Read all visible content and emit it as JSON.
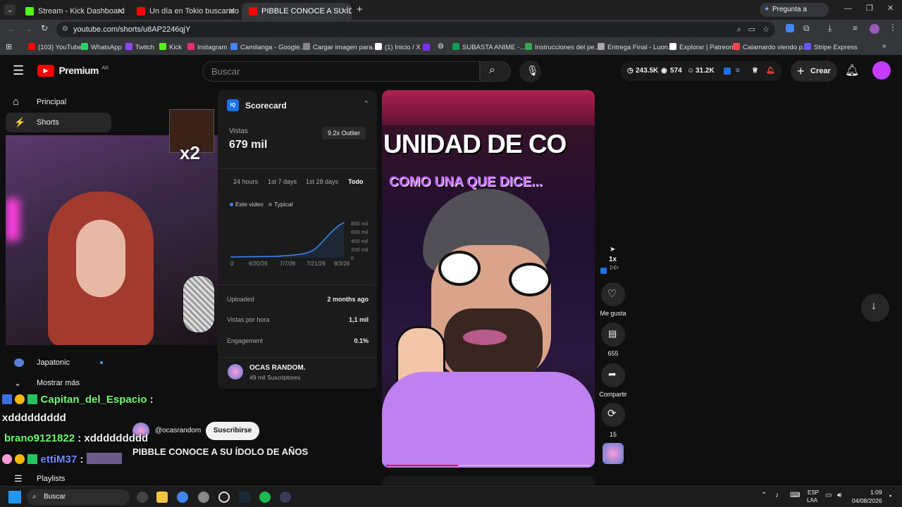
{
  "browser": {
    "tabs": [
      {
        "title": "Stream - Kick Dashboard",
        "color": "#53fc18"
      },
      {
        "title": "Un día en Tokio buscando JOYA",
        "color": "#ff0000"
      },
      {
        "title": "PIBBLE CONOCE A SU ÍDOLO",
        "color": "#ff0000"
      }
    ],
    "new_tab": "+",
    "gemini": "Pregunta a Gemini",
    "url": "youtube.com/shorts/u8AP2246qjY",
    "bookmarks": [
      {
        "label": "(103) YouTube",
        "color": "#ff0000"
      },
      {
        "label": "WhatsApp",
        "color": "#25d366"
      },
      {
        "label": "Twitch",
        "color": "#9146ff"
      },
      {
        "label": "Kick",
        "color": "#53fc18"
      },
      {
        "label": "Instagram",
        "color": "#e1306c"
      },
      {
        "label": "Camilanga - Google...",
        "color": "#4285f4"
      },
      {
        "label": "Cargar imagen para...",
        "color": "#888888"
      },
      {
        "label": "(1) Inicio / X",
        "color": "#ffffff"
      },
      {
        "label": "SUBASTA ANIME -...",
        "color": "#0f9d58"
      },
      {
        "label": "Instrucciones del pe...",
        "color": "#34a853"
      },
      {
        "label": "Entrega Final - Luon...",
        "color": "#aaaaaa"
      },
      {
        "label": "Explorar | Patreon",
        "color": "#ffffff"
      },
      {
        "label": "Calamardo viendo p...",
        "color": "#ff4444"
      },
      {
        "label": "Stripe Express",
        "color": "#635bff"
      }
    ]
  },
  "yt": {
    "logo": "Premium",
    "region": "AR",
    "search_placeholder": "Buscar",
    "stats": {
      "subs": "243.5K",
      "views": "574",
      "other": "31.2K"
    },
    "create": "Crear",
    "sidebar": [
      {
        "label": "Principal"
      },
      {
        "label": "Shorts"
      },
      {
        "label": "Japatonic"
      },
      {
        "label": "Mostrar más"
      },
      {
        "label": "Playlists"
      }
    ]
  },
  "scorecard": {
    "title": "Scorecard",
    "views_label": "Vistas",
    "views_value": "679 mil",
    "outlier": "9.2x Outlier",
    "ranges": [
      "24 hours",
      "1st 7 days",
      "1st 28 days",
      "Todo"
    ],
    "legend_this": "Este video",
    "legend_typical": "Typical",
    "y_ticks": [
      "800 mil",
      "600 mil",
      "400 mil",
      "200 mil",
      "0"
    ],
    "x_ticks": [
      "0",
      "6/20/26",
      "7/7/26",
      "7/21/26",
      "8/3/26"
    ],
    "rows": [
      {
        "label": "Uploaded",
        "value": "2 months ago"
      },
      {
        "label": "Vistas por hora",
        "value": "1,1 mil"
      },
      {
        "label": "Engagement",
        "value": "0.1%"
      }
    ],
    "channel_name": "OCAS RANDOM.",
    "channel_subs": "49 mil Suscriptores"
  },
  "video": {
    "headline": "UNIDAD DE CO",
    "subline": "COMO UNA QUE DICE...",
    "channel_handle": "@ocasrandom",
    "subscribe": "Suscribirse",
    "title": "PIBBLE CONOCE A SU ÍDOLO DE AÑOS",
    "speed": "1x"
  },
  "actions": {
    "like_label": "Me gusta",
    "comments": "655",
    "share_label": "Compartir",
    "remix": "15"
  },
  "overlay": {
    "multiplier": "x2",
    "chat": [
      {
        "user": "Capitan_del_Espacio",
        "msg": "",
        "color": "#6dff6d"
      },
      {
        "user": "",
        "msg": "xddddddddd",
        "color": "#ffffff"
      },
      {
        "user": "brano9121822",
        "msg": ": xddddddddd",
        "color": "#6dff6d"
      },
      {
        "user": "ettiM37",
        "msg": ":",
        "color": "#6d8cff"
      }
    ]
  },
  "taskbar": {
    "search": "Buscar",
    "lang": "ESP",
    "lang2": "LAA",
    "time": "1:09",
    "date": "04/08/2026"
  }
}
